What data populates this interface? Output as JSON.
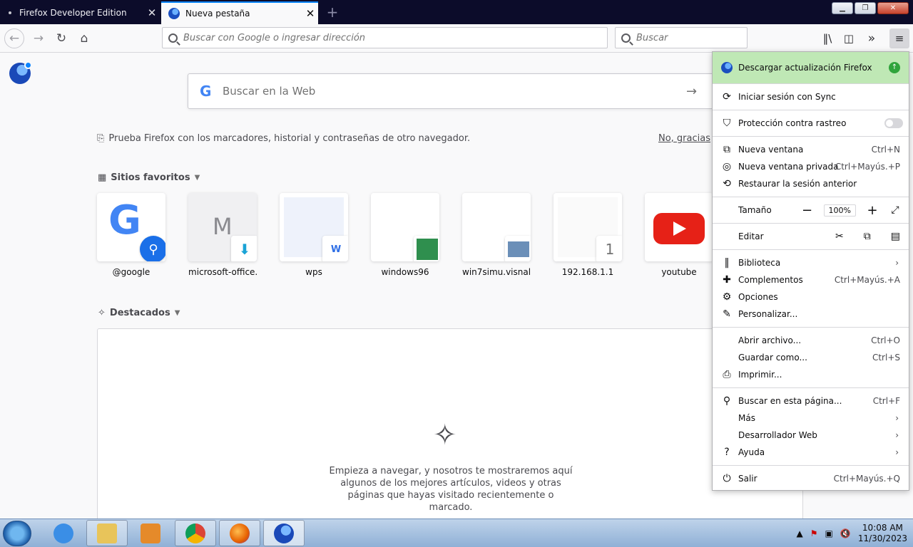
{
  "tabs": [
    {
      "label": "Firefox Developer Edition",
      "active": false
    },
    {
      "label": "Nueva pestaña",
      "active": true
    }
  ],
  "nav": {
    "url_placeholder": "Buscar con Google o ingresar dirección",
    "search_placeholder": "Buscar"
  },
  "newtab": {
    "websearch_placeholder": "Buscar en la Web",
    "import_text": "Prueba Firefox con los marcadores, historial y contraseñas de otro navegador.",
    "import_dismiss": "No, gracias",
    "topsites_heading": "Sitios favoritos",
    "topsites": [
      {
        "title": "@google"
      },
      {
        "title": "microsoft-office..."
      },
      {
        "title": "wps"
      },
      {
        "title": "windows96"
      },
      {
        "title": "win7simu.visnali..."
      },
      {
        "title": "192.168.1.1",
        "badge": "1"
      },
      {
        "title": "youtube"
      }
    ],
    "highlights_heading": "Destacados",
    "highlights_empty": "Empieza a navegar, y nosotros te mostraremos aquí algunos de los mejores artículos, videos y otras páginas que hayas visitado recientemente o marcado."
  },
  "menu": {
    "update": "Descargar actualización Firefox",
    "sync": "Iniciar sesión con Sync",
    "tracking": "Protección contra rastreo",
    "new_window": "Nueva ventana",
    "new_window_sc": "Ctrl+N",
    "private_window": "Nueva ventana privada",
    "private_window_sc": "Ctrl+Mayús.+P",
    "restore": "Restaurar la sesión anterior",
    "zoom_label": "Tamaño",
    "zoom_value": "100%",
    "edit_label": "Editar",
    "library": "Biblioteca",
    "addons": "Complementos",
    "addons_sc": "Ctrl+Mayús.+A",
    "options": "Opciones",
    "customize": "Personalizar...",
    "open_file": "Abrir archivo...",
    "open_file_sc": "Ctrl+O",
    "save_as": "Guardar como...",
    "save_as_sc": "Ctrl+S",
    "print": "Imprimir...",
    "find": "Buscar en esta página...",
    "find_sc": "Ctrl+F",
    "more": "Más",
    "webdev": "Desarrollador Web",
    "help": "Ayuda",
    "quit": "Salir",
    "quit_sc": "Ctrl+Mayús.+Q"
  },
  "taskbar": {
    "time": "10:08 AM",
    "date": "11/30/2023"
  }
}
